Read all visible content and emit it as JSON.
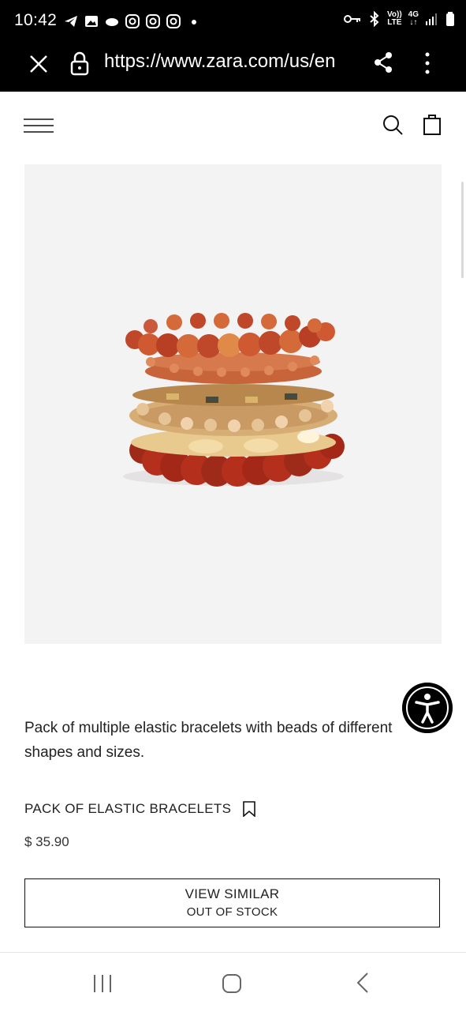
{
  "status_bar": {
    "time": "10:42",
    "network_top": "Vo))",
    "network_bottom": "LTE",
    "signal_top": "4G",
    "signal_bottom": "↓↑"
  },
  "browser": {
    "url": "https://www.zara.com/us/en"
  },
  "header": {
    "icons": [
      "menu-icon",
      "search-icon",
      "bag-icon"
    ]
  },
  "product": {
    "description": "Pack of multiple elastic bracelets with beads of different shapes and sizes.",
    "name": "PACK OF ELASTIC BRACELETS",
    "price": "$ 35.90",
    "button_line1": "VIEW SIMILAR",
    "button_line2": "OUT OF STOCK"
  },
  "colors": {
    "image_bg": "#f4f3f3",
    "bead_red": "#b5301c",
    "bead_amber": "#c8643a",
    "bead_gold": "#d6ad74"
  }
}
